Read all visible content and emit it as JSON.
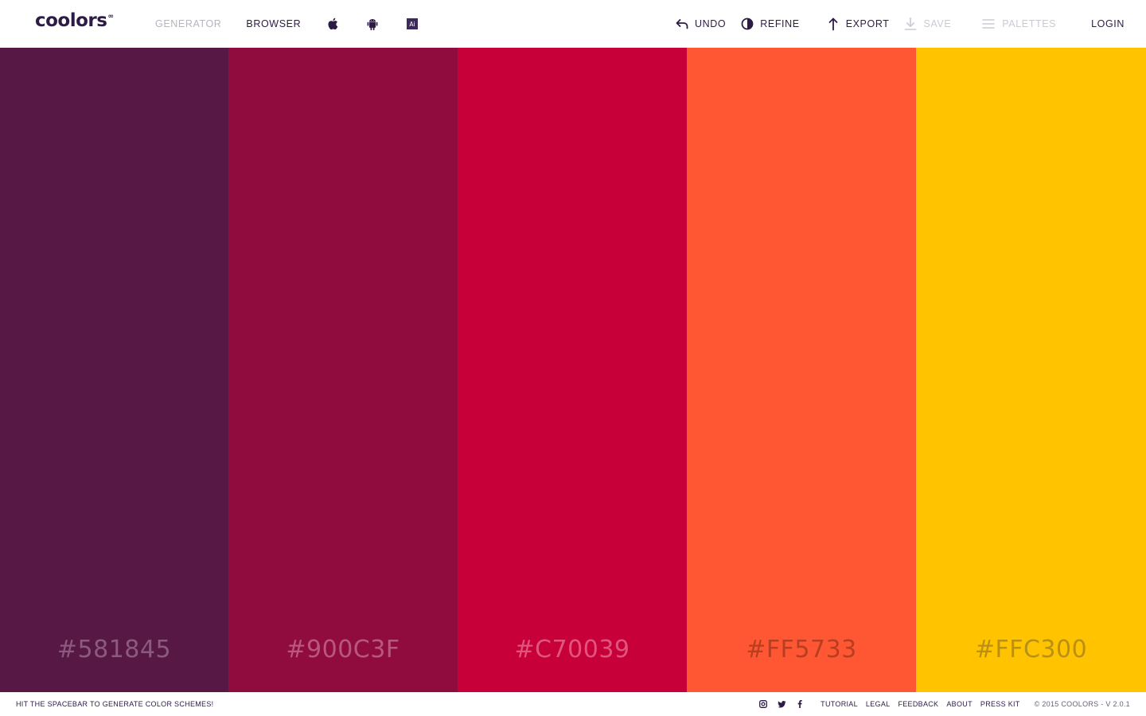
{
  "header": {
    "logo_text": "coolors",
    "logo_mark": "∞",
    "nav": {
      "generator": "GENERATOR",
      "browser": "BROWSER"
    },
    "platform_icons": [
      "apple-icon",
      "android-icon",
      "adobe-illustrator-icon"
    ],
    "adobe_icon_text": "Ai",
    "tools": {
      "undo": "UNDO",
      "refine": "REFINE",
      "export": "EXPORT",
      "save": "SAVE",
      "palettes": "PALETTES"
    },
    "login": "LOGIN"
  },
  "palette": {
    "colors": [
      {
        "hex": "#581845",
        "label": "#581845",
        "label_color": "#8a5a7f"
      },
      {
        "hex": "#900C3F",
        "label": "#900C3F",
        "label_color": "#b8587a"
      },
      {
        "hex": "#C70039",
        "label": "#C70039",
        "label_color": "#e0557c"
      },
      {
        "hex": "#FF5733",
        "label": "#FF5733",
        "label_color": "#b83e22"
      },
      {
        "hex": "#FFC300",
        "label": "#FFC300",
        "label_color": "#b89016"
      }
    ]
  },
  "footer": {
    "tip": "HIT THE SPACEBAR TO GENERATE COLOR SCHEMES!",
    "social_icons": [
      "instagram-icon",
      "twitter-icon",
      "facebook-icon"
    ],
    "links": {
      "tutorial": "TUTORIAL",
      "legal": "LEGAL",
      "feedback": "FEEDBACK",
      "about": "ABOUT",
      "press_kit": "PRESS KIT"
    },
    "copyright": "© 2015 COOLORS - V 2.0.1"
  },
  "colors": {
    "brand": "#2d1b45",
    "muted": "#b9b3c2",
    "disabled": "#cdc8d3"
  }
}
